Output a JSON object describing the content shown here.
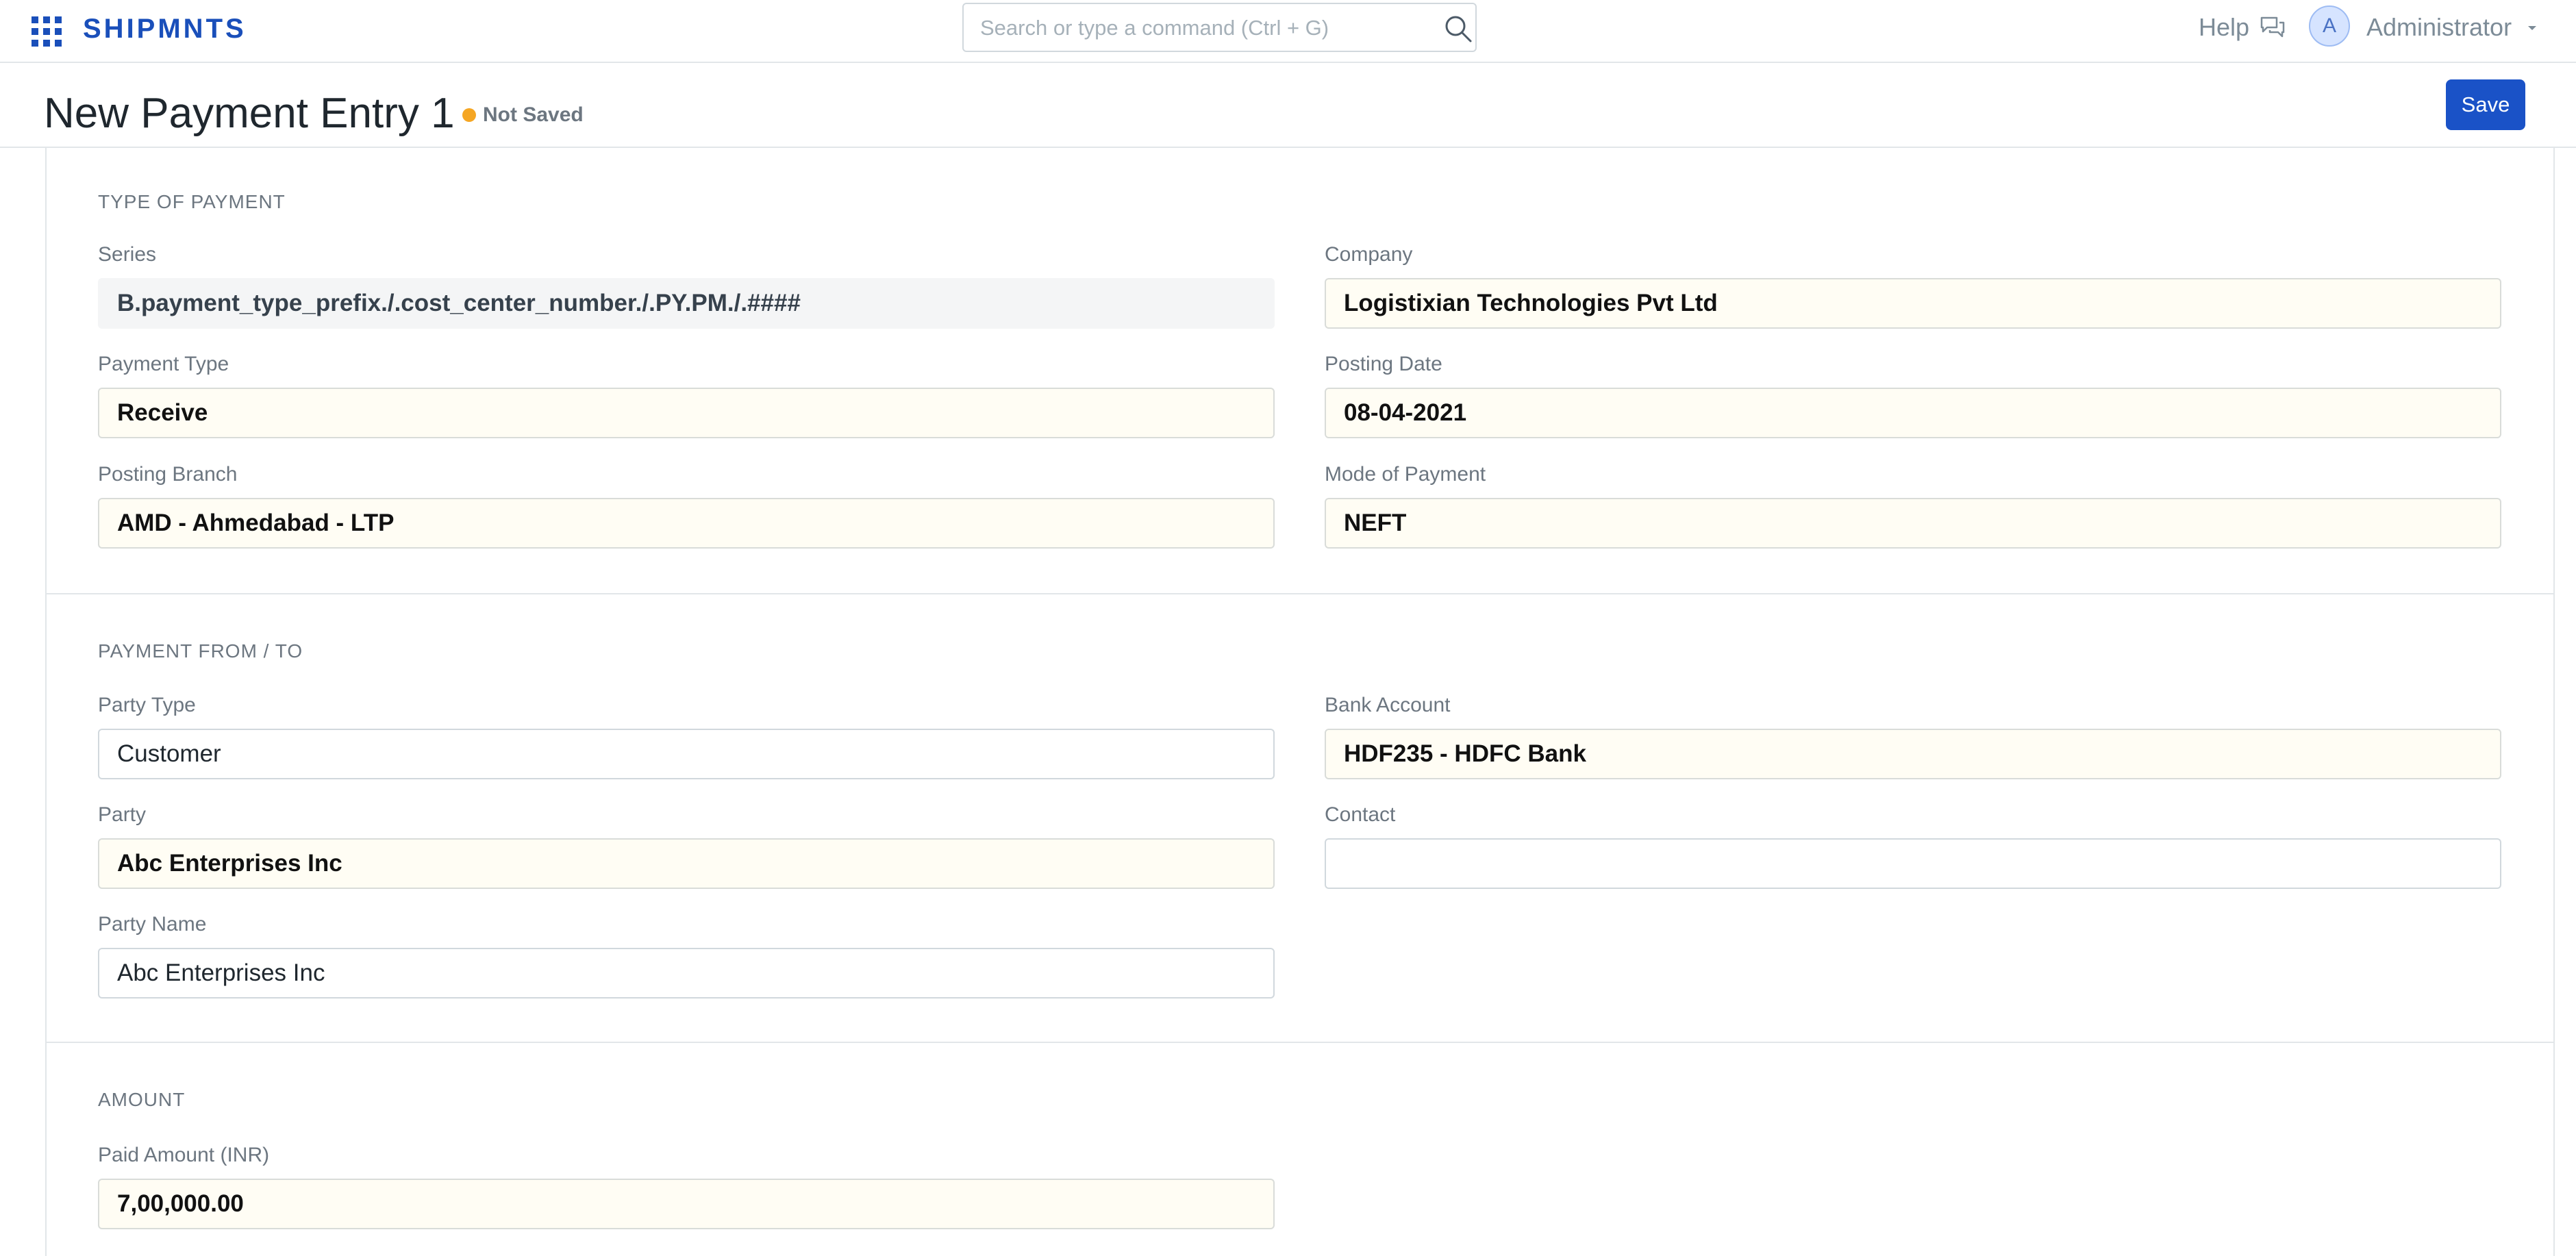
{
  "navbar": {
    "brand": "SHIPMNTS",
    "search_placeholder": "Search or type a command (Ctrl + G)",
    "help_label": "Help",
    "avatar_initial": "A",
    "user_name": "Administrator"
  },
  "page": {
    "title": "New Payment Entry 1",
    "status": "Not Saved",
    "status_color": "#f5a623",
    "save_label": "Save",
    "accent_color": "#1a52c7"
  },
  "sections": {
    "type_of_payment": {
      "heading": "TYPE OF PAYMENT",
      "series_label": "Series",
      "series_value": "B.payment_type_prefix./.cost_center_number./.PY.PM./.####",
      "company_label": "Company",
      "company_value": "Logistixian Technologies Pvt Ltd",
      "payment_type_label": "Payment Type",
      "payment_type_value": "Receive",
      "posting_date_label": "Posting Date",
      "posting_date_value": "08-04-2021",
      "posting_branch_label": "Posting Branch",
      "posting_branch_value": "AMD - Ahmedabad - LTP",
      "mode_of_payment_label": "Mode of Payment",
      "mode_of_payment_value": "NEFT"
    },
    "payment_from_to": {
      "heading": "PAYMENT FROM / TO",
      "party_type_label": "Party Type",
      "party_type_value": "Customer",
      "bank_account_label": "Bank Account",
      "bank_account_value": "HDF235 - HDFC Bank",
      "party_label": "Party",
      "party_value": "Abc Enterprises Inc",
      "contact_label": "Contact",
      "contact_value": "",
      "party_name_label": "Party Name",
      "party_name_value": "Abc Enterprises Inc"
    },
    "amount": {
      "heading": "AMOUNT",
      "paid_amount_label": "Paid Amount (INR)",
      "paid_amount_value": "7,00,000.00"
    }
  }
}
